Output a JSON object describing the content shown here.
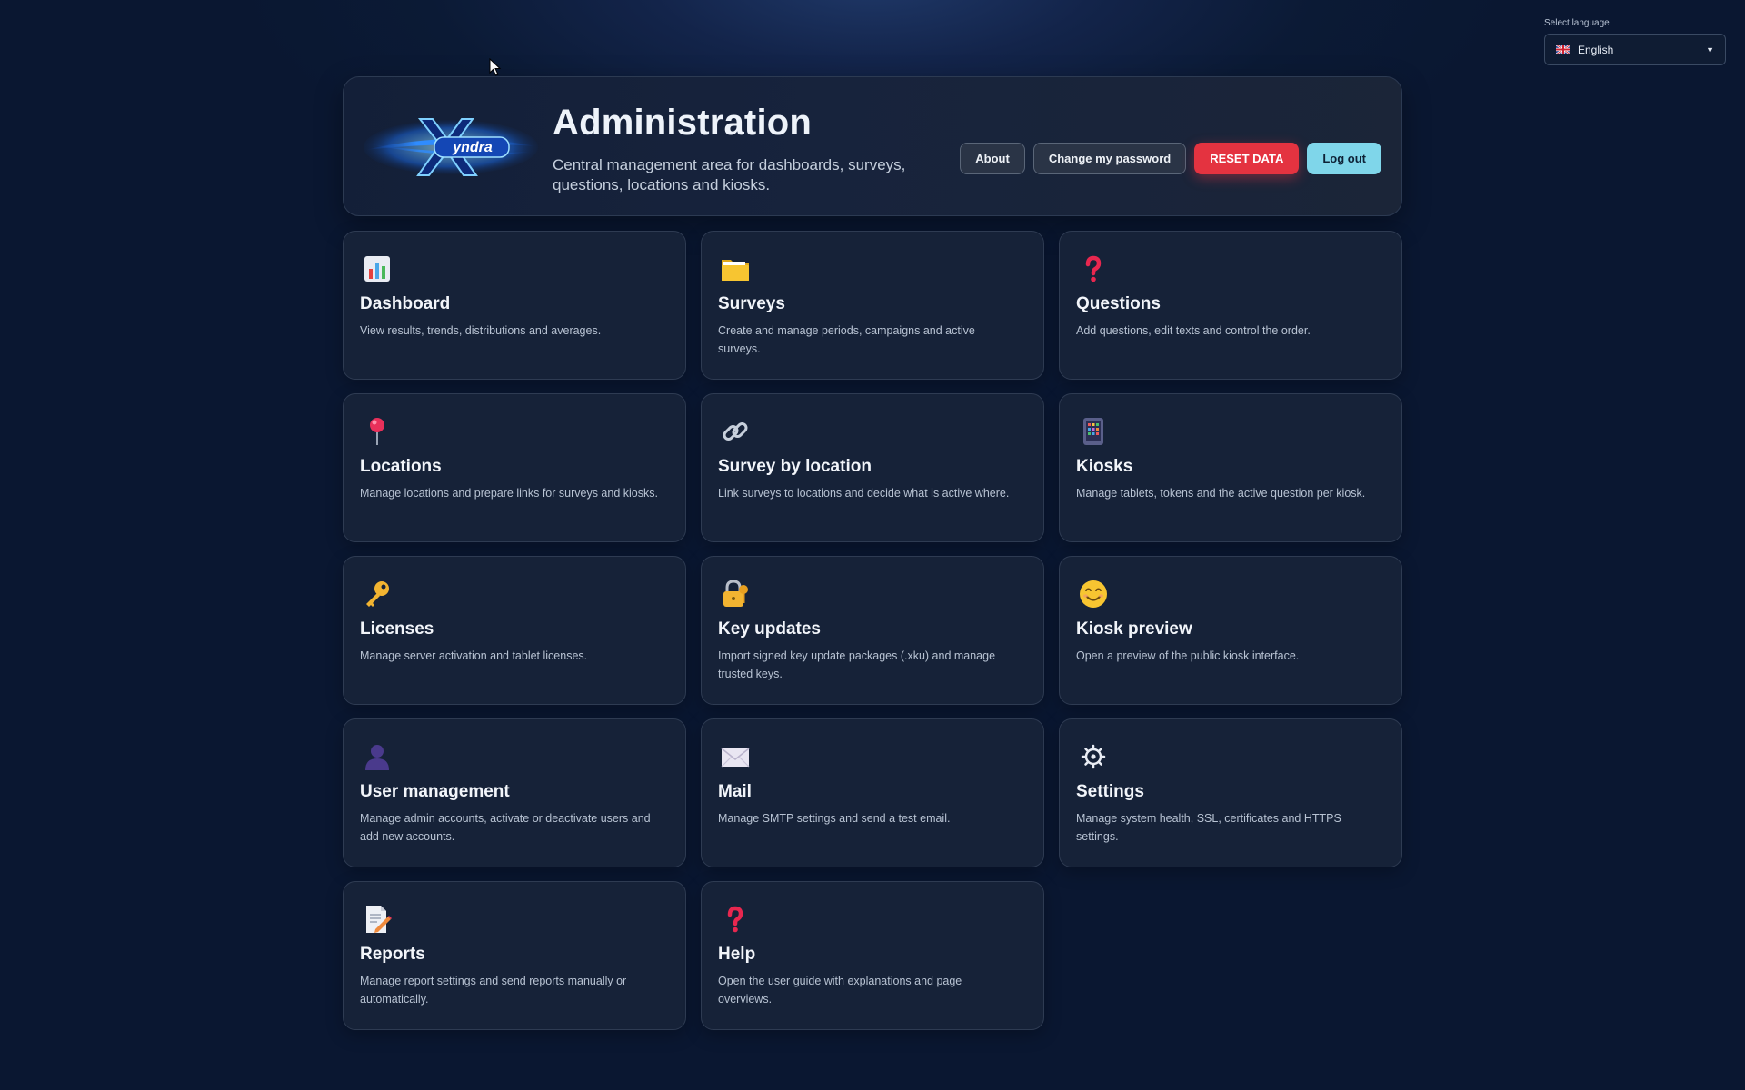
{
  "language": {
    "label": "Select language",
    "selected": "English",
    "flag_icon": "uk-flag-icon"
  },
  "header": {
    "logo_text": "Xyndra",
    "title": "Administration",
    "subtitle": "Central management area for dashboards, surveys, questions, locations and kiosks.",
    "buttons": {
      "about": "About",
      "change_password": "Change my password",
      "reset_data": "RESET DATA",
      "logout": "Log out"
    }
  },
  "colors": {
    "background": "#0a1731",
    "card": "#162238",
    "danger": "#e43340",
    "logout": "#7fd6ea"
  },
  "tiles": [
    {
      "icon": "bar-chart-icon",
      "title": "Dashboard",
      "description": "View results, trends, distributions and averages."
    },
    {
      "icon": "folder-icon",
      "title": "Surveys",
      "description": "Create and manage periods, campaigns and active surveys."
    },
    {
      "icon": "question-mark-icon",
      "title": "Questions",
      "description": "Add questions, edit texts and control the order."
    },
    {
      "icon": "pushpin-icon",
      "title": "Locations",
      "description": "Manage locations and prepare links for surveys and kiosks."
    },
    {
      "icon": "link-icon",
      "title": "Survey by location",
      "description": "Link surveys to locations and decide what is active where."
    },
    {
      "icon": "tablet-icon",
      "title": "Kiosks",
      "description": "Manage tablets, tokens and the active question per kiosk."
    },
    {
      "icon": "key-icon",
      "title": "Licenses",
      "description": "Manage server activation and tablet licenses."
    },
    {
      "icon": "lock-key-icon",
      "title": "Key updates",
      "description": "Import signed key update packages (.xku) and manage trusted keys."
    },
    {
      "icon": "smiley-icon",
      "title": "Kiosk preview",
      "description": "Open a preview of the public kiosk interface."
    },
    {
      "icon": "user-icon",
      "title": "User management",
      "description": "Manage admin accounts, activate or deactivate users and add new accounts."
    },
    {
      "icon": "envelope-icon",
      "title": "Mail",
      "description": "Manage SMTP settings and send a test email."
    },
    {
      "icon": "gear-icon",
      "title": "Settings",
      "description": "Manage system health, SSL, certificates and HTTPS settings."
    },
    {
      "icon": "report-icon",
      "title": "Reports",
      "description": "Manage report settings and send reports manually or automatically."
    },
    {
      "icon": "question-mark-icon",
      "title": "Help",
      "description": "Open the user guide with explanations and page overviews."
    }
  ]
}
